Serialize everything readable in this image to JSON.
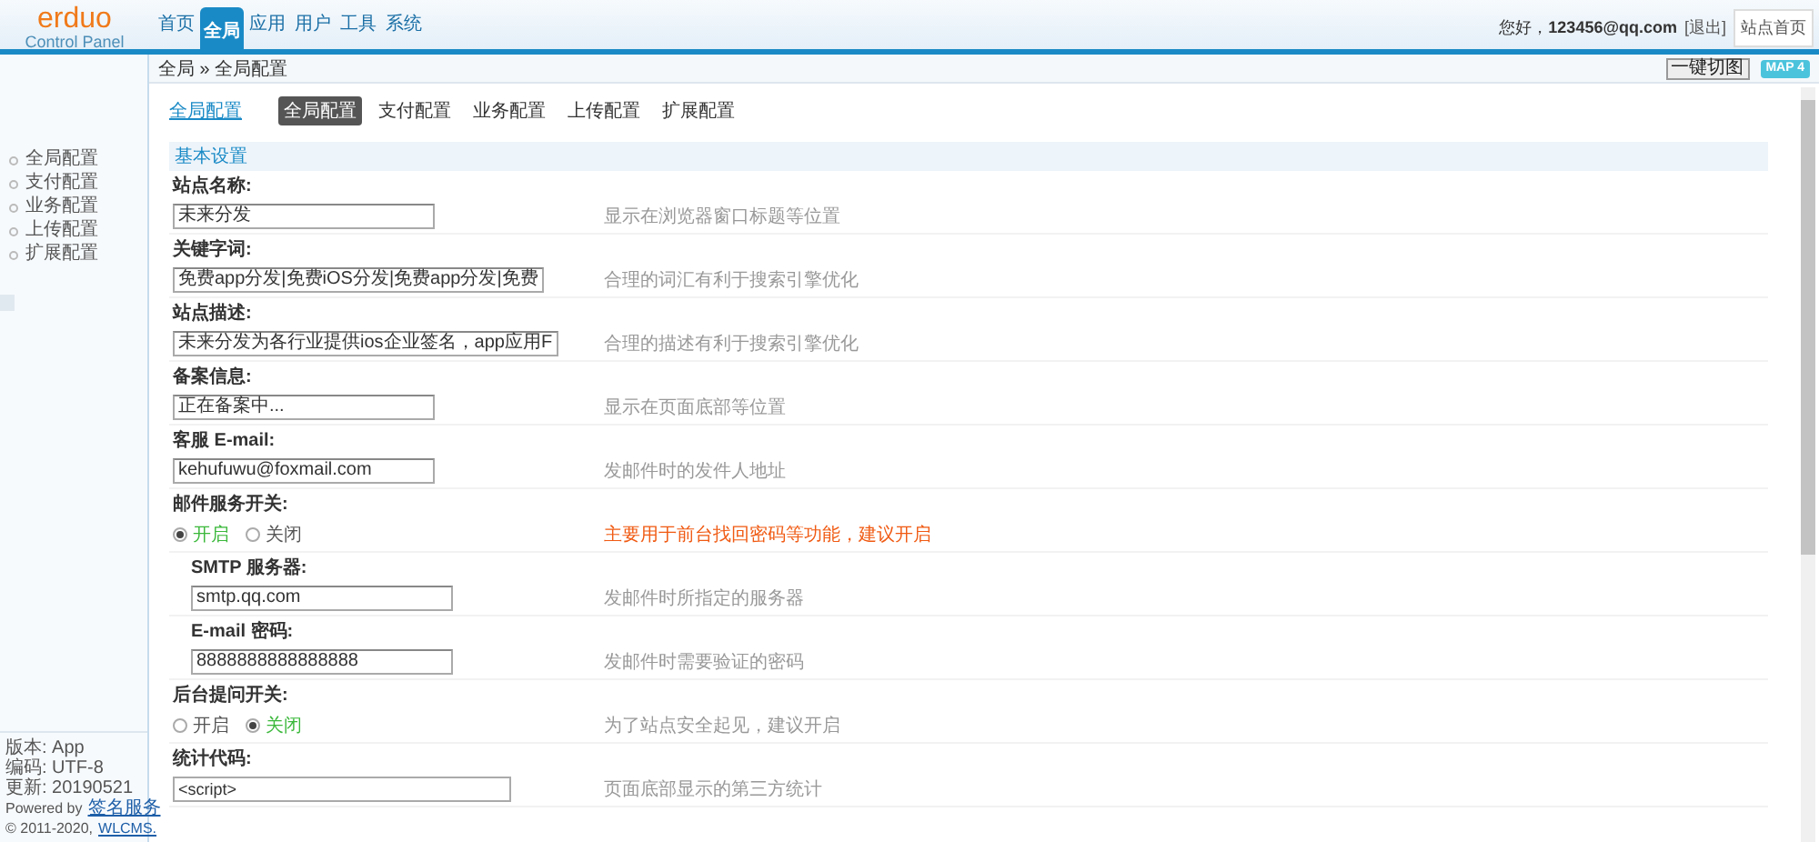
{
  "logo": {
    "name": "erduo",
    "subtitle": "Control Panel"
  },
  "nav": [
    {
      "label": "首页",
      "selected": false
    },
    {
      "label": "全局",
      "selected": true
    },
    {
      "label": "应用",
      "selected": false
    },
    {
      "label": "用户",
      "selected": false
    },
    {
      "label": "工具",
      "selected": false
    },
    {
      "label": "系统",
      "selected": false
    }
  ],
  "user": {
    "greeting": "您好，",
    "email": "123456@qq.com",
    "logout": "[退出]",
    "site_home": "站点首页"
  },
  "breadcrumb": "全局 » 全局配置",
  "actions": {
    "refresh": "一键切图",
    "map": "MAP 4"
  },
  "sidebar": {
    "items": [
      {
        "label": "全局配置",
        "selected": false
      },
      {
        "label": "支付配置",
        "selected": false
      },
      {
        "label": "业务配置",
        "selected": false
      },
      {
        "label": "上传配置",
        "selected": false
      },
      {
        "label": "扩展配置",
        "selected": false
      }
    ],
    "footer": {
      "version": "版本: App",
      "encoding": "编码: UTF-8",
      "updated": "更新: 20190521",
      "powered_prefix": "Powered by",
      "powered_link": "签名服务",
      "copyright_prefix": "© 2011-2020,",
      "copyright_link": "WLCMS."
    }
  },
  "page_title": "全局配置",
  "tabs": [
    {
      "label": "全局配置",
      "selected": true
    },
    {
      "label": "支付配置",
      "selected": false
    },
    {
      "label": "业务配置",
      "selected": false
    },
    {
      "label": "上传配置",
      "selected": false
    },
    {
      "label": "扩展配置",
      "selected": false
    }
  ],
  "section": "基本设置",
  "fields": [
    {
      "kind": "text",
      "label": "站点名称:",
      "value": "未来分发",
      "hint": "显示在浏览器窗口标题等位置",
      "warn": false
    },
    {
      "kind": "text",
      "label": "关键字词:",
      "value": "免费app分发|免费iOS分发|免费app分发|免费",
      "hint": "合理的词汇有利于搜索引擎优化",
      "warn": false
    },
    {
      "kind": "text",
      "label": "站点描述:",
      "value": "未来分发为各行业提供ios企业签名，app应用F",
      "hint": "合理的描述有利于搜索引擎优化",
      "warn": false
    },
    {
      "kind": "text",
      "label": "备案信息:",
      "value": "正在备案中...",
      "hint": "显示在页面底部等位置",
      "warn": false
    },
    {
      "kind": "text",
      "label": "客服 E-mail:",
      "value": "kehufuwu@foxmail.com",
      "hint": "发邮件时的发件人地址",
      "warn": false
    },
    {
      "kind": "radio",
      "label": "邮件服务开关:",
      "options": [
        {
          "label": "开启",
          "selected": true
        },
        {
          "label": "关闭",
          "selected": false
        }
      ],
      "hint": "主要用于前台找回密码等功能，建议开启",
      "warn": true
    },
    {
      "kind": "subtext",
      "label": "SMTP 服务器:",
      "value": "smtp.qq.com",
      "hint": "发邮件时所指定的服务器",
      "warn": false
    },
    {
      "kind": "subtext",
      "label": "E-mail 密码:",
      "value": "8888888888888888",
      "hint": "发邮件时需要验证的密码",
      "warn": false
    },
    {
      "kind": "radio",
      "label": "后台提问开关:",
      "options": [
        {
          "label": "开启",
          "selected": false
        },
        {
          "label": "关闭",
          "selected": true
        }
      ],
      "hint": "为了站点安全起见，建议开启",
      "warn": false
    },
    {
      "kind": "textarea",
      "label": "统计代码:",
      "value": "<script>",
      "hint": "页面底部显示的第三方统计",
      "warn": false
    }
  ]
}
